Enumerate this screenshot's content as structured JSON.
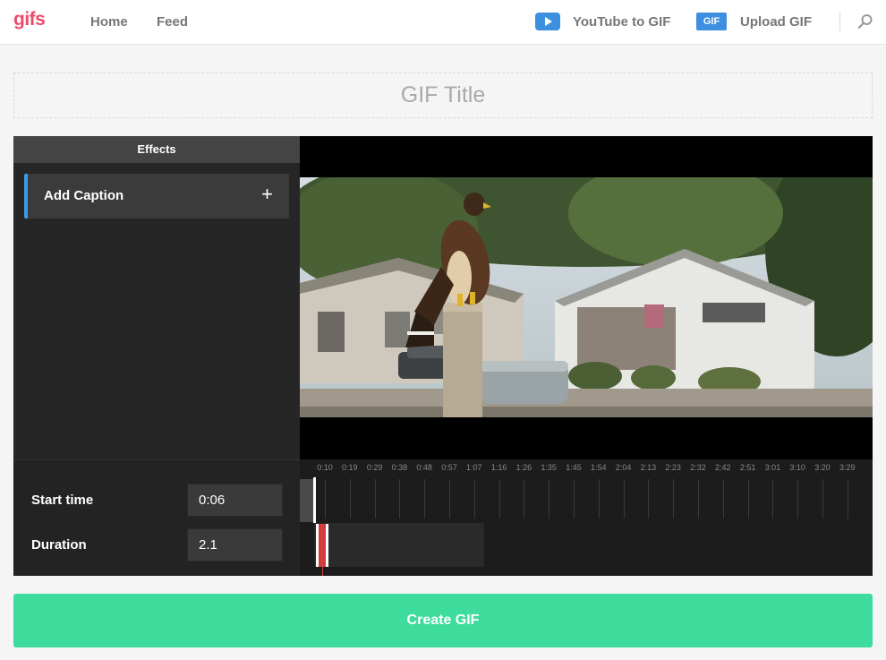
{
  "header": {
    "logo": "gifs",
    "nav": {
      "home": "Home",
      "feed": "Feed"
    },
    "youtube_to_gif": "YouTube to GIF",
    "gif_badge": "GIF",
    "upload_gif": "Upload GIF"
  },
  "title_field": {
    "placeholder": "GIF Title"
  },
  "effects": {
    "header": "Effects",
    "add_caption": "Add Caption",
    "plus_symbol": "+"
  },
  "controls": {
    "start_time_label": "Start time",
    "start_time_value": "0:06",
    "duration_label": "Duration",
    "duration_value": "2.1"
  },
  "timeline": {
    "ticks": [
      "0:10",
      "0:19",
      "0:29",
      "0:38",
      "0:48",
      "0:57",
      "1:07",
      "1:16",
      "1:26",
      "1:35",
      "1:45",
      "1:54",
      "2:04",
      "2:13",
      "2:23",
      "2:32",
      "2:42",
      "2:51",
      "3:01",
      "3:10",
      "3:20",
      "3:29"
    ]
  },
  "create_button": "Create GIF",
  "colors": {
    "brand": "#ec4b6b",
    "accent_blue": "#3d8fe0",
    "create_green": "#3ddc9d",
    "selection_red": "#d63a3a"
  }
}
